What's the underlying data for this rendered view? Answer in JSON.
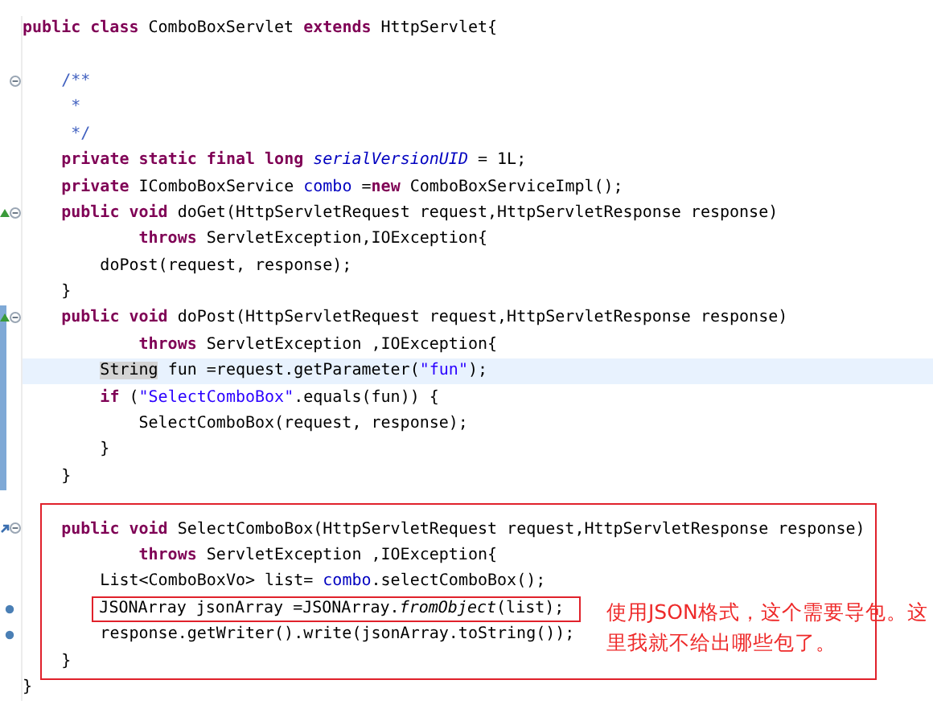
{
  "code": [
    {
      "kind": "line",
      "tokens": [
        {
          "kind": "keyword",
          "text": "public class"
        },
        {
          "kind": "plain",
          "text": " ComboBoxServlet "
        },
        {
          "kind": "keyword",
          "text": "extends"
        },
        {
          "kind": "plain",
          "text": " HttpServlet{"
        }
      ]
    },
    {
      "kind": "blank"
    },
    {
      "kind": "line",
      "foldable": true,
      "tokens": [
        {
          "kind": "comment",
          "text": "    /**"
        }
      ]
    },
    {
      "kind": "line",
      "tokens": [
        {
          "kind": "comment",
          "text": "     *"
        }
      ]
    },
    {
      "kind": "line",
      "tokens": [
        {
          "kind": "comment",
          "text": "     */"
        }
      ]
    },
    {
      "kind": "line",
      "tokens": [
        {
          "kind": "keyword",
          "text": "    private static final long "
        },
        {
          "kind": "static_field",
          "text": "serialVersionUID"
        },
        {
          "kind": "plain",
          "text": " = 1L;"
        }
      ]
    },
    {
      "kind": "line",
      "tokens": [
        {
          "kind": "keyword",
          "text": "    private"
        },
        {
          "kind": "plain",
          "text": " IComboBoxService "
        },
        {
          "kind": "field",
          "text": "combo"
        },
        {
          "kind": "plain",
          "text": " ="
        },
        {
          "kind": "keyword",
          "text": "new"
        },
        {
          "kind": "plain",
          "text": " ComboBoxServiceImpl();"
        }
      ]
    },
    {
      "kind": "line",
      "foldable": true,
      "overrides": true,
      "tokens": [
        {
          "kind": "keyword",
          "text": "    public void"
        },
        {
          "kind": "plain",
          "text": " doGet(HttpServletRequest request,HttpServletResponse response)"
        }
      ]
    },
    {
      "kind": "line",
      "tokens": [
        {
          "kind": "keyword",
          "text": "            throws"
        },
        {
          "kind": "plain",
          "text": " ServletException,IOException{"
        }
      ]
    },
    {
      "kind": "line",
      "tokens": [
        {
          "kind": "plain",
          "text": "        doPost(request, response);"
        }
      ]
    },
    {
      "kind": "line",
      "tokens": [
        {
          "kind": "plain",
          "text": "    }"
        }
      ]
    },
    {
      "kind": "line",
      "foldable": true,
      "overrides": true,
      "in_range": true,
      "tokens": [
        {
          "kind": "keyword",
          "text": "    public void"
        },
        {
          "kind": "plain",
          "text": " doPost(HttpServletRequest request,HttpServletResponse response)"
        }
      ]
    },
    {
      "kind": "line",
      "in_range": true,
      "tokens": [
        {
          "kind": "keyword",
          "text": "            throws"
        },
        {
          "kind": "plain",
          "text": " ServletException ,IOException{"
        }
      ]
    },
    {
      "kind": "line",
      "in_range": true,
      "highlighted": true,
      "tokens": [
        {
          "kind": "plain",
          "text": "        String",
          "marked": true
        },
        {
          "kind": "plain",
          "text": " fun =request.getParameter("
        },
        {
          "kind": "string",
          "text": "\"fun\""
        },
        {
          "kind": "plain",
          "text": ");"
        }
      ]
    },
    {
      "kind": "line",
      "in_range": true,
      "tokens": [
        {
          "kind": "keyword",
          "text": "        if"
        },
        {
          "kind": "plain",
          "text": " ("
        },
        {
          "kind": "string",
          "text": "\"SelectComboBox\""
        },
        {
          "kind": "plain",
          "text": ".equals(fun)) {"
        }
      ]
    },
    {
      "kind": "line",
      "in_range": true,
      "tokens": [
        {
          "kind": "plain",
          "text": "            SelectComboBox(request, response);"
        }
      ]
    },
    {
      "kind": "line",
      "in_range": true,
      "tokens": [
        {
          "kind": "plain",
          "text": "        }"
        }
      ]
    },
    {
      "kind": "line",
      "in_range": true,
      "tokens": [
        {
          "kind": "plain",
          "text": "    }"
        }
      ]
    },
    {
      "kind": "blank"
    },
    {
      "kind": "annotated_block",
      "note": "使用JSON格式，这个需要导包。这里我就不给出哪些包了。",
      "lines": [
        {
          "kind": "line",
          "foldable": true,
          "implements": true,
          "tokens": [
            {
              "kind": "keyword",
              "text": "    public void"
            },
            {
              "kind": "plain",
              "text": " SelectComboBox(HttpServletRequest request,HttpServletResponse response)"
            }
          ]
        },
        {
          "kind": "line",
          "tokens": [
            {
              "kind": "keyword",
              "text": "            throws"
            },
            {
              "kind": "plain",
              "text": " ServletException ,IOException{"
            }
          ]
        },
        {
          "kind": "line",
          "tokens": [
            {
              "kind": "plain",
              "text": "        List<ComboBoxVo> list= "
            },
            {
              "kind": "field",
              "text": "combo"
            },
            {
              "kind": "plain",
              "text": ".selectComboBox();"
            }
          ]
        },
        {
          "kind": "line",
          "occurrence": true,
          "boxed": true,
          "tokens": [
            {
              "kind": "plain",
              "text": "        JSONArray jsonArray =JSONArray."
            },
            {
              "kind": "static_method",
              "text": "fromObject"
            },
            {
              "kind": "plain",
              "text": "(list);"
            }
          ]
        },
        {
          "kind": "line",
          "occurrence": true,
          "tokens": [
            {
              "kind": "plain",
              "text": "        response.getWriter().write(jsonArray.toString());"
            }
          ]
        },
        {
          "kind": "line",
          "tokens": [
            {
              "kind": "plain",
              "text": "    }"
            }
          ]
        }
      ]
    },
    {
      "kind": "line",
      "tokens": [
        {
          "kind": "plain",
          "text": "}"
        }
      ]
    }
  ]
}
